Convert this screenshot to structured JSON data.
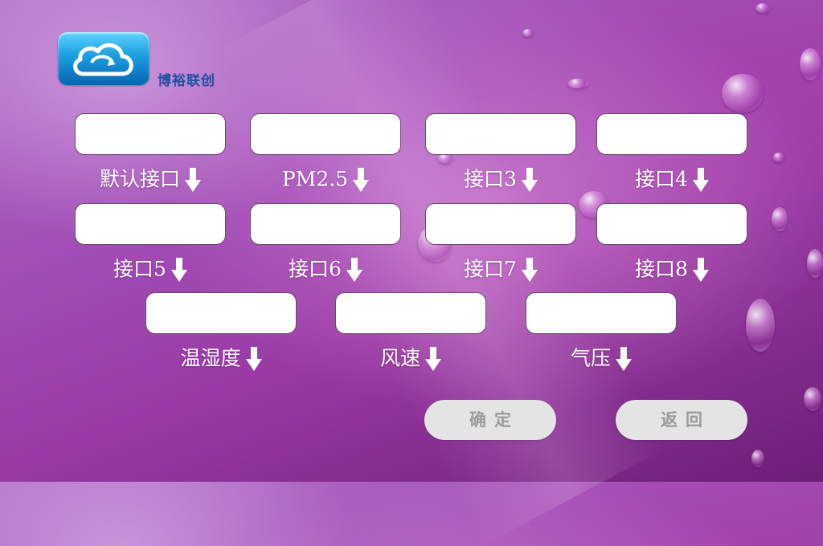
{
  "brand": {
    "name": "博裕联创"
  },
  "fields": [
    {
      "label": "默认接口"
    },
    {
      "label": "PM2.5"
    },
    {
      "label": "接口3"
    },
    {
      "label": "接口4"
    },
    {
      "label": "接口5"
    },
    {
      "label": "接口6"
    },
    {
      "label": "接口7"
    },
    {
      "label": "接口8"
    },
    {
      "label": "温湿度"
    },
    {
      "label": "风速"
    },
    {
      "label": "气压"
    }
  ],
  "buttons": {
    "confirm": "确定",
    "back": "返回"
  },
  "icons": {
    "logo": "cloud-sync-icon",
    "arrow": "arrow-down-icon"
  },
  "colors": {
    "brand_text": "#1f4fa0",
    "button_bg": "#e4e4e4",
    "button_text": "#9a9a9a"
  }
}
